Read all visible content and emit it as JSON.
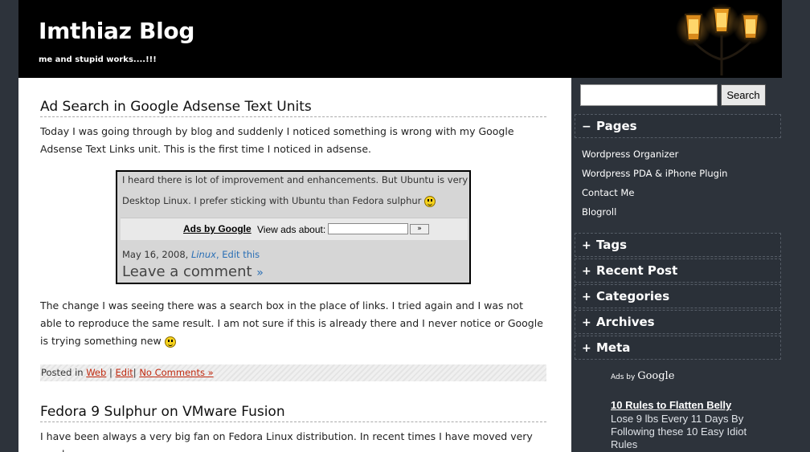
{
  "header": {
    "title": "Imthiaz Blog",
    "description": "me and stupid works....!!!"
  },
  "post1": {
    "title": "Ad Search in Google Adsense Text Units",
    "intro": "Today I was going through by blog and suddenly I noticed something is wrong with my Google Adsense Text Links unit. This is the first time I noticed in adsense.",
    "screenshot": {
      "line1": "I heard there is lot of improvement and enhancements. But Ubuntu is very fa",
      "line2": "Desktop Linux. I prefer sticking with Ubuntu than Fedora sulphur",
      "ads_label": "Ads by Google",
      "view_label": "View ads about:",
      "btn_label": "»",
      "date": "May 16, 2008,",
      "category": "Linux",
      "edit": "Edit this",
      "leave": "Leave a comment",
      "leave_arrow": "»"
    },
    "body": "The change I was seeing there was a search box in the place of links. I tried again and I was not able to reproduce the same result. I am not sure if this is already there and I never notice or Google is trying something new",
    "meta": {
      "posted_in": "Posted in",
      "category": "Web",
      "sep1": "|",
      "edit": "Edit",
      "sep2": "|",
      "comments": "No Comments »"
    }
  },
  "post2": {
    "title": "Fedora 9 Sulphur on VMware Fusion",
    "intro": "I have been always a very big fan on Fedora Linux distribution. In recent times I have moved very much"
  },
  "sidebar": {
    "search_button": "Search",
    "pages_title": "Pages",
    "pages": [
      "Wordpress Organizer",
      "Wordpress PDA & iPhone Plugin",
      "Contact Me",
      "Blogroll"
    ],
    "widgets": [
      "Tags",
      "Recent Post",
      "Categories",
      "Archives",
      "Meta"
    ],
    "minus": "−",
    "plus": "+",
    "ads_by": "Ads by",
    "google": "Google",
    "ad_title": "10 Rules to Flatten Belly",
    "ad_body": "Lose 9 lbs Every 11 Days By Following these 10 Easy Idiot Rules"
  }
}
